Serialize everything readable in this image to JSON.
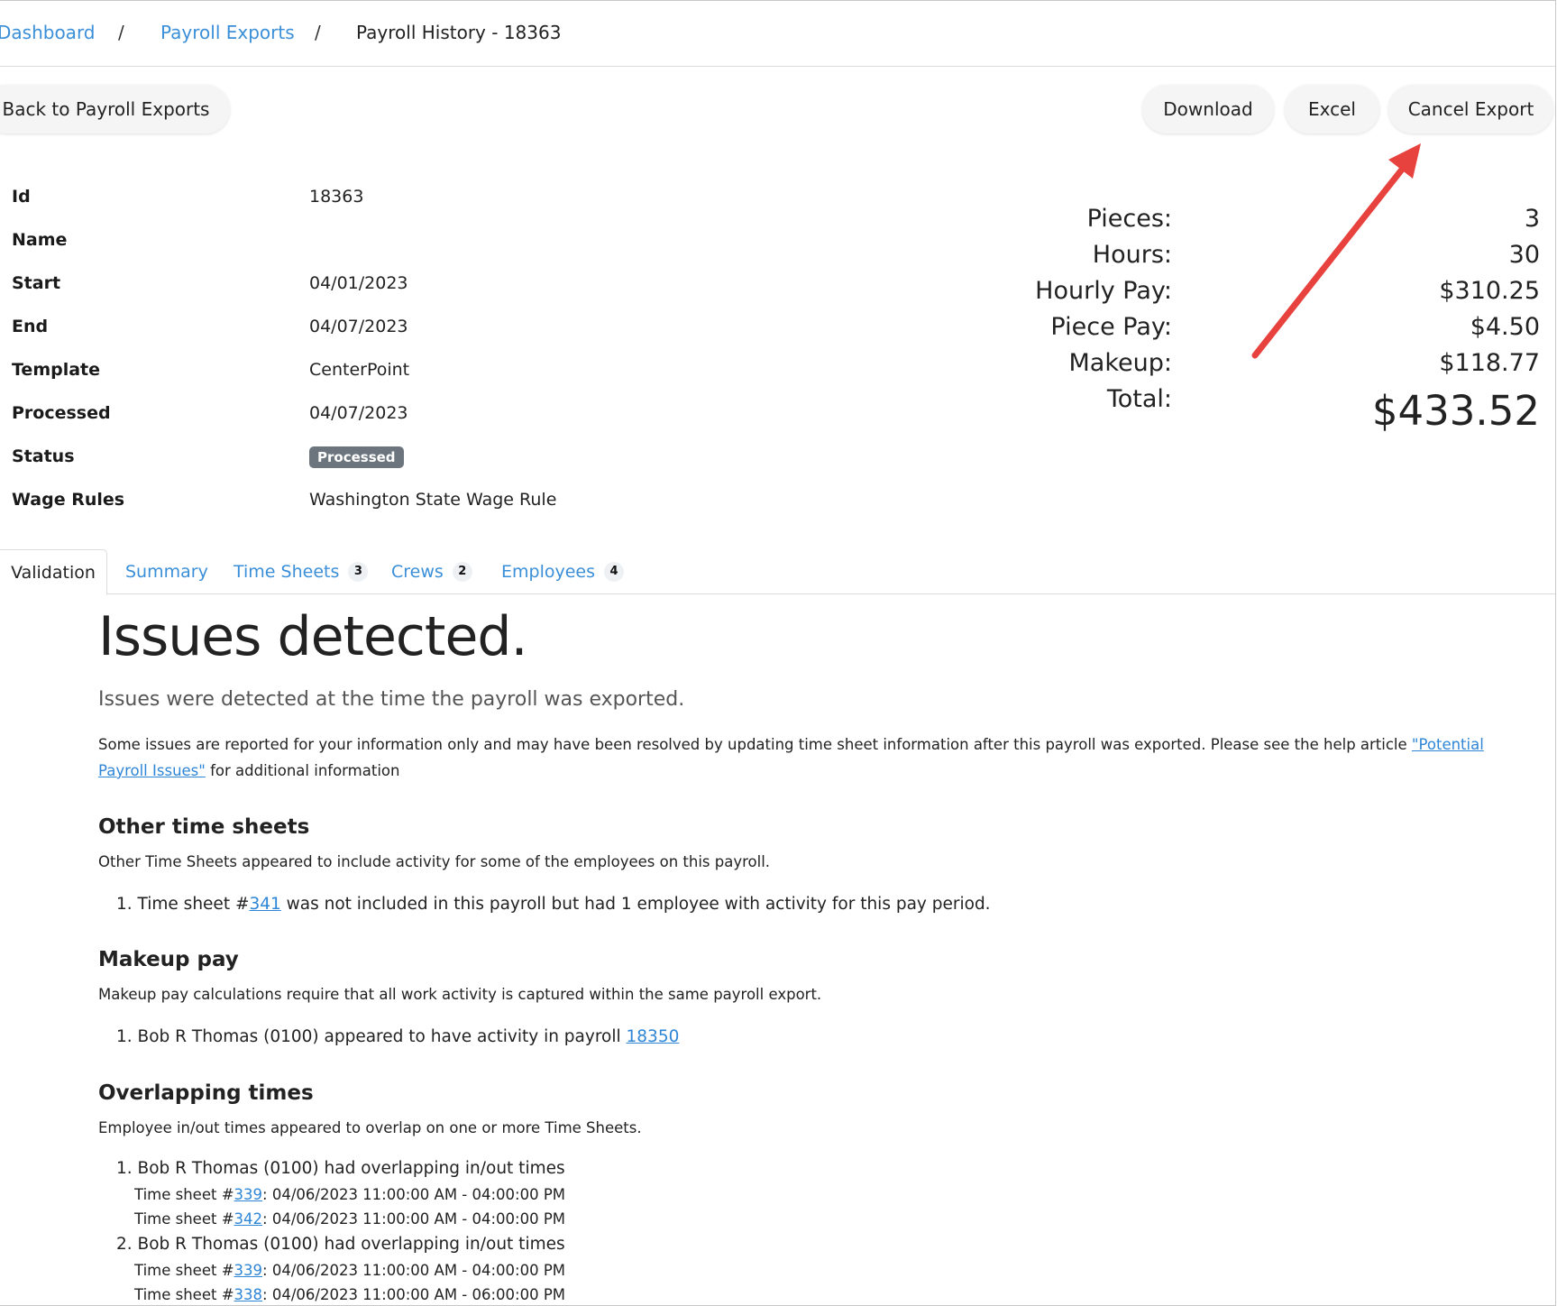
{
  "breadcrumb": {
    "dashboard": "Dashboard",
    "sep1": "/",
    "payroll_exports": "Payroll Exports",
    "sep2": "/",
    "current": "Payroll History - 18363"
  },
  "toolbar": {
    "back_label": "Back to Payroll Exports",
    "download_label": "Download",
    "excel_label": "Excel",
    "cancel_label": "Cancel Export"
  },
  "details": {
    "id_label": "Id",
    "id_value": "18363",
    "name_label": "Name",
    "name_value": "",
    "start_label": "Start",
    "start_value": "04/01/2023",
    "end_label": "End",
    "end_value": "04/07/2023",
    "template_label": "Template",
    "template_value": "CenterPoint",
    "processed_label": "Processed",
    "processed_value": "04/07/2023",
    "status_label": "Status",
    "status_value": "Processed",
    "wage_label": "Wage Rules",
    "wage_value": "Washington State Wage Rule"
  },
  "totals": {
    "pieces_label": "Pieces:",
    "pieces_value": "3",
    "hours_label": "Hours:",
    "hours_value": "30",
    "hourly_label": "Hourly Pay:",
    "hourly_value": "$310.25",
    "piece_label": "Piece Pay:",
    "piece_value": "$4.50",
    "makeup_label": "Makeup:",
    "makeup_value": "$118.77",
    "total_label": "Total:",
    "total_value": "$433.52"
  },
  "tabs": {
    "validation": "Validation",
    "summary": "Summary",
    "timesheets": "Time Sheets",
    "timesheets_count": "3",
    "crews": "Crews",
    "crews_count": "2",
    "employees": "Employees",
    "employees_count": "4"
  },
  "validation": {
    "title": "Issues detected.",
    "lead": "Issues were detected at the time the payroll was exported.",
    "note_before": "Some issues are reported for your information only and may have been resolved by updating time sheet information after this payroll was exported. Please see the help article ",
    "note_link": "\"Potential Payroll Issues\"",
    "note_after": " for additional information",
    "other": {
      "heading": "Other time sheets",
      "desc": "Other Time Sheets appeared to include activity for some of the employees on this payroll.",
      "item1_prefix": "1. Time sheet #",
      "item1_link": "341",
      "item1_suffix": " was not included in this payroll but had 1 employee with activity for this pay period."
    },
    "makeup": {
      "heading": "Makeup pay",
      "desc": "Makeup pay calculations require that all work activity is captured within the same payroll export.",
      "item1_prefix": "1. Bob R Thomas (0100) appeared to have activity in payroll ",
      "item1_link": "18350"
    },
    "overlap": {
      "heading": "Overlapping times",
      "desc": "Employee in/out times appeared to overlap on one or more Time Sheets.",
      "item1": "1. Bob R Thomas (0100) had overlapping in/out times",
      "item1_sub1_prefix": "Time sheet #",
      "item1_sub1_link": "339",
      "item1_sub1_time": ": 04/06/2023 11:00:00 AM - 04:00:00 PM",
      "item1_sub2_prefix": "Time sheet #",
      "item1_sub2_link": "342",
      "item1_sub2_time": ": 04/06/2023 11:00:00 AM - 04:00:00 PM",
      "item2": "2. Bob R Thomas (0100) had overlapping in/out times",
      "item2_sub1_prefix": "Time sheet #",
      "item2_sub1_link": "339",
      "item2_sub1_time": ": 04/06/2023 11:00:00 AM - 04:00:00 PM",
      "item2_sub2_prefix": "Time sheet #",
      "item2_sub2_link": "338",
      "item2_sub2_time": ": 04/06/2023 11:00:00 AM - 06:00:00 PM"
    }
  },
  "colors": {
    "link": "#3a8fd8",
    "badge": "#6c757d",
    "arrow": "#e8423f"
  }
}
